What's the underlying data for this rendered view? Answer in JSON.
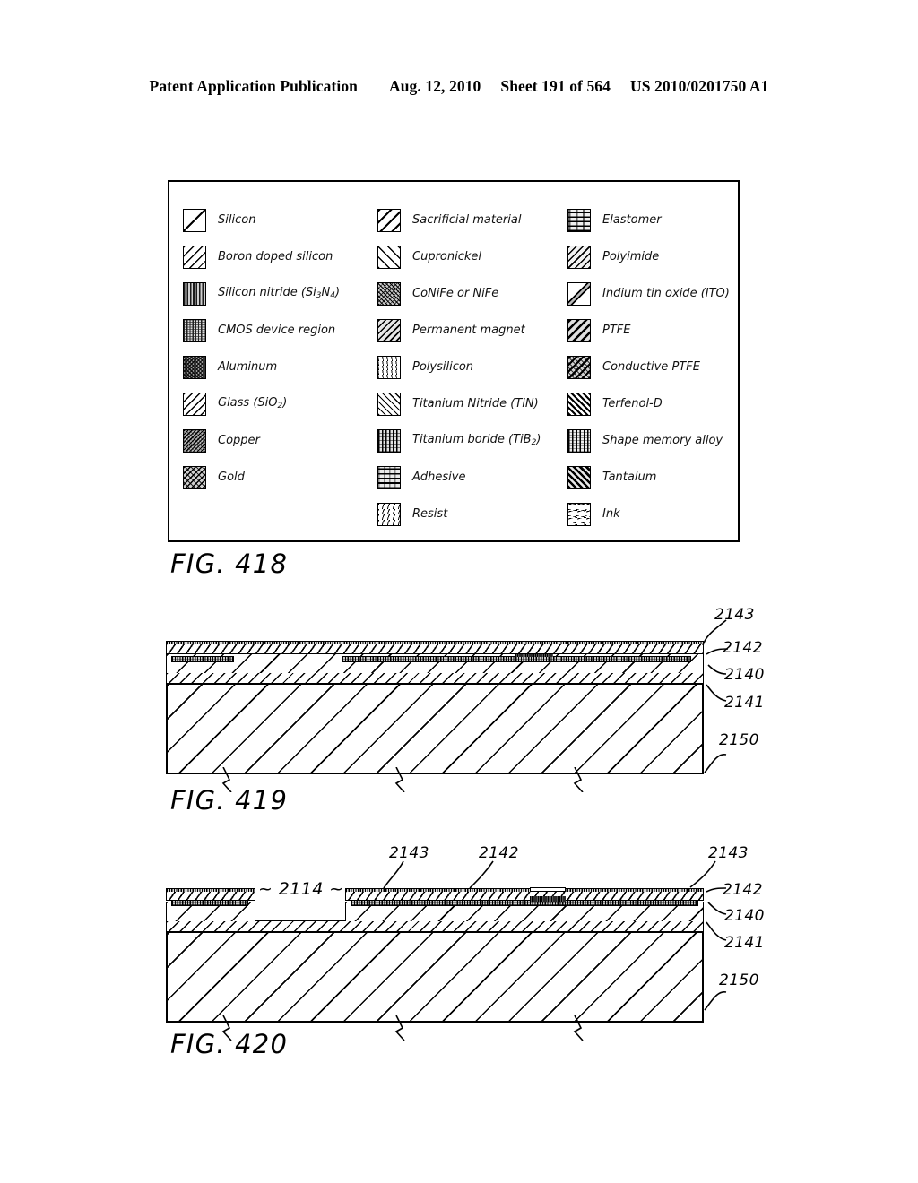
{
  "header": {
    "publication": "Patent Application Publication",
    "date": "Aug. 12, 2010",
    "sheet": "Sheet 191 of 564",
    "number": "US 2010/0201750 A1"
  },
  "figures": {
    "fig418": {
      "caption": "FIG. 418"
    },
    "fig419": {
      "caption": "FIG. 419"
    },
    "fig420": {
      "caption": "FIG. 420"
    }
  },
  "legend": {
    "columns": [
      {
        "items": [
          {
            "label": "Silicon",
            "pattern": "single-diagonal-line"
          },
          {
            "label": "Boron doped silicon",
            "pattern": "dense-diagonal-hatch"
          },
          {
            "label": "Silicon nitride (Si3N4)",
            "label_main": "Silicon nitride (Si",
            "sub1": "3",
            "mid": "N",
            "sub2": "4",
            "tail": ")",
            "pattern": "vertical-stripes"
          },
          {
            "label": "CMOS device region",
            "pattern": "mixed-vertical-speckle"
          },
          {
            "label": "Aluminum",
            "pattern": "crosshatch-dark"
          },
          {
            "label": "Glass (SiO2)",
            "label_main": "Glass (SiO",
            "sub1": "2",
            "tail": ")",
            "pattern": "wide-diagonal-hatch"
          },
          {
            "label": "Copper",
            "pattern": "fine-crosshatch"
          },
          {
            "label": "Gold",
            "pattern": "diagonal-crosshatch"
          }
        ]
      },
      {
        "items": [
          {
            "label": "Sacrificial material",
            "pattern": "thick-diagonal-hatch"
          },
          {
            "label": "Cupronickel",
            "pattern": "reverse-diagonal-hatch"
          },
          {
            "label": "CoNiFe or NiFe",
            "pattern": "fine-reverse-crosshatch"
          },
          {
            "label": "Permanent magnet",
            "pattern": "medium-diagonal-hatch"
          },
          {
            "label": "Polysilicon",
            "pattern": "short-dash-diagonal"
          },
          {
            "label": "Titanium Nitride (TiN)",
            "pattern": "reverse-fine-hatch"
          },
          {
            "label": "Titanium boride (TiB2)",
            "label_main": "Titanium boride (TiB",
            "sub1": "2",
            "tail": ")",
            "pattern": "vertical-dotted-stripes"
          },
          {
            "label": "Adhesive",
            "pattern": "horizontal-bands"
          },
          {
            "label": "Resist",
            "pattern": "sparse-dash-diagonal"
          }
        ]
      },
      {
        "items": [
          {
            "label": "Elastomer",
            "pattern": "horizontal-text-bands"
          },
          {
            "label": "Polyimide",
            "pattern": "diagonal-hatch-light"
          },
          {
            "label": "Indium tin oxide (ITO)",
            "pattern": "single-thick-diagonal-band"
          },
          {
            "label": "PTFE",
            "pattern": "bold-diagonal-hatch"
          },
          {
            "label": "Conductive PTFE",
            "pattern": "bold-diagonal-crosshatch"
          },
          {
            "label": "Terfenol-D",
            "pattern": "dense-reverse-hatch"
          },
          {
            "label": "Shape memory alloy",
            "pattern": "vertical-dense-stripes"
          },
          {
            "label": "Tantalum",
            "pattern": "bold-reverse-hatch"
          },
          {
            "label": "Ink",
            "pattern": "wave-dashes"
          }
        ]
      }
    ]
  },
  "refs": {
    "fig419": [
      {
        "id": "2143",
        "value": "2143"
      },
      {
        "id": "2142",
        "value": "2142"
      },
      {
        "id": "2140",
        "value": "2140"
      },
      {
        "id": "2141",
        "value": "2141"
      },
      {
        "id": "2150",
        "value": "2150"
      }
    ],
    "fig420": [
      {
        "id": "2143-top-left",
        "value": "2143"
      },
      {
        "id": "2142-top",
        "value": "2142"
      },
      {
        "id": "2143-top-right",
        "value": "2143"
      },
      {
        "id": "2142-right",
        "value": "2142"
      },
      {
        "id": "2140-right",
        "value": "2140"
      },
      {
        "id": "2141-right",
        "value": "2141"
      },
      {
        "id": "2150-right",
        "value": "2150"
      },
      {
        "id": "2114-gap",
        "value": "~ 2114 ~"
      }
    ]
  }
}
